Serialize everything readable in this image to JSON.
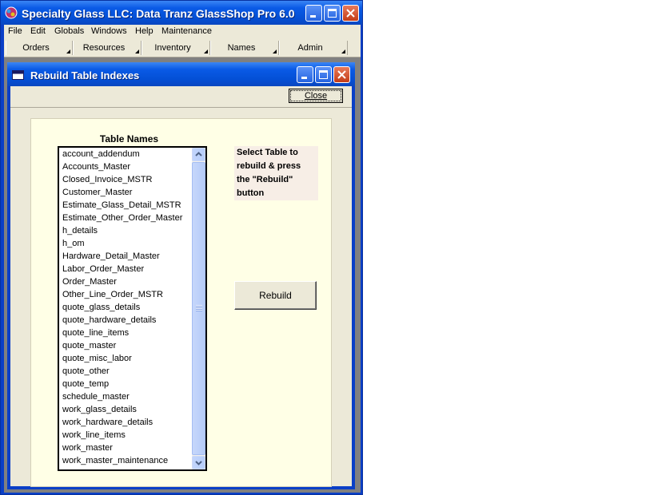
{
  "app": {
    "title": "Specialty Glass LLC: Data Tranz GlassShop Pro 6.0"
  },
  "menu": [
    "File",
    "Edit",
    "Globals",
    "Windows",
    "Help",
    "Maintenance"
  ],
  "toolbar": [
    "Orders",
    "Resources",
    "Inventory",
    "Names",
    "Admin"
  ],
  "child_window": {
    "title": "Rebuild Table Indexes",
    "close_label": "Close"
  },
  "panel": {
    "list_label": "Table Names",
    "tables": [
      "account_addendum",
      "Accounts_Master",
      "Closed_Invoice_MSTR",
      "Customer_Master",
      "Estimate_Glass_Detail_MSTR",
      "Estimate_Other_Order_Master",
      "h_details",
      "h_om",
      "Hardware_Detail_Master",
      "Labor_Order_Master",
      "Order_Master",
      "Other_Line_Order_MSTR",
      "quote_glass_details",
      "quote_hardware_details",
      "quote_line_items",
      "quote_master",
      "quote_misc_labor",
      "quote_other",
      "quote_temp",
      "schedule_master",
      "work_glass_details",
      "work_hardware_details",
      "work_line_items",
      "work_master",
      "work_master_maintenance"
    ],
    "instructions": [
      "Select Table to",
      "rebuild & press",
      "the \"Rebuild\"",
      "button"
    ],
    "rebuild_label": "Rebuild"
  },
  "colors": {
    "titlebar": "#0a5ae6",
    "panel_bg": "#ffffe6",
    "window_bg": "#ece9d8",
    "mdi_bg": "#808080"
  }
}
